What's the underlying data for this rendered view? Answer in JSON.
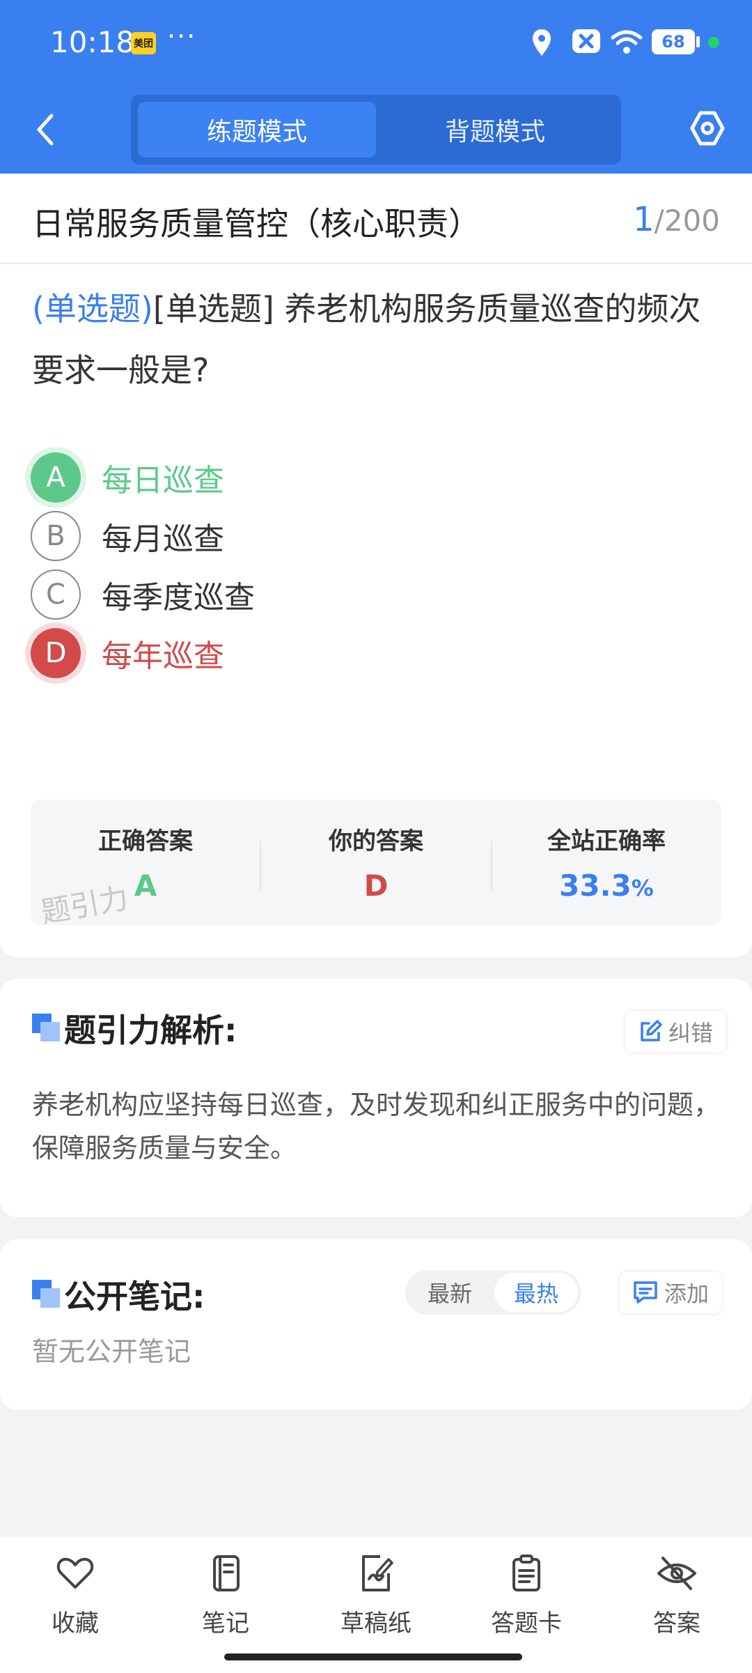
{
  "status_bar": {
    "time": "10:18",
    "app_badge": "美团",
    "more": "···",
    "battery": "68"
  },
  "header": {
    "back_icon": "chevron-left-icon",
    "tabs": [
      {
        "label": "练题模式",
        "active": true
      },
      {
        "label": "背题模式",
        "active": false
      }
    ],
    "settings_icon": "hexagon-settings-icon",
    "color": "#3a7ff0"
  },
  "question": {
    "category": "日常服务质量管控（核心职责）",
    "current": "1",
    "separator": "/",
    "total": "200",
    "type_tag": "(单选题)",
    "text": "[单选题] 养老机构服务质量巡查的频次要求一般是?",
    "options": [
      {
        "letter": "A",
        "text": "每日巡查",
        "state": "correct"
      },
      {
        "letter": "B",
        "text": "每月巡查",
        "state": "normal"
      },
      {
        "letter": "C",
        "text": "每季度巡查",
        "state": "normal"
      },
      {
        "letter": "D",
        "text": "每年巡查",
        "state": "wrong"
      }
    ]
  },
  "result": {
    "correct_label": "正确答案",
    "correct_value": "A",
    "yours_label": "你的答案",
    "yours_value": "D",
    "rate_label": "全站正确率",
    "rate_value": "33.3",
    "rate_unit": "%",
    "watermark": "题引力",
    "colors": {
      "correct": "#5cc98a",
      "wrong": "#d24a4a",
      "rate": "#3a7ff0"
    }
  },
  "analysis": {
    "title": "题引力解析:",
    "report_button": "纠错",
    "text": "养老机构应坚持每日巡查，及时发现和纠正服务中的问题，保障服务质量与安全。"
  },
  "notes": {
    "title": "公开笔记:",
    "sort_newest": "最新",
    "sort_hot": "最热",
    "add_button": "添加",
    "empty": "暂无公开笔记"
  },
  "bottom_nav": [
    {
      "label": "收藏",
      "icon": "heart-icon"
    },
    {
      "label": "笔记",
      "icon": "notebook-icon"
    },
    {
      "label": "草稿纸",
      "icon": "draft-paper-icon"
    },
    {
      "label": "答题卡",
      "icon": "answer-sheet-icon"
    },
    {
      "label": "答案",
      "icon": "eye-off-icon"
    }
  ]
}
